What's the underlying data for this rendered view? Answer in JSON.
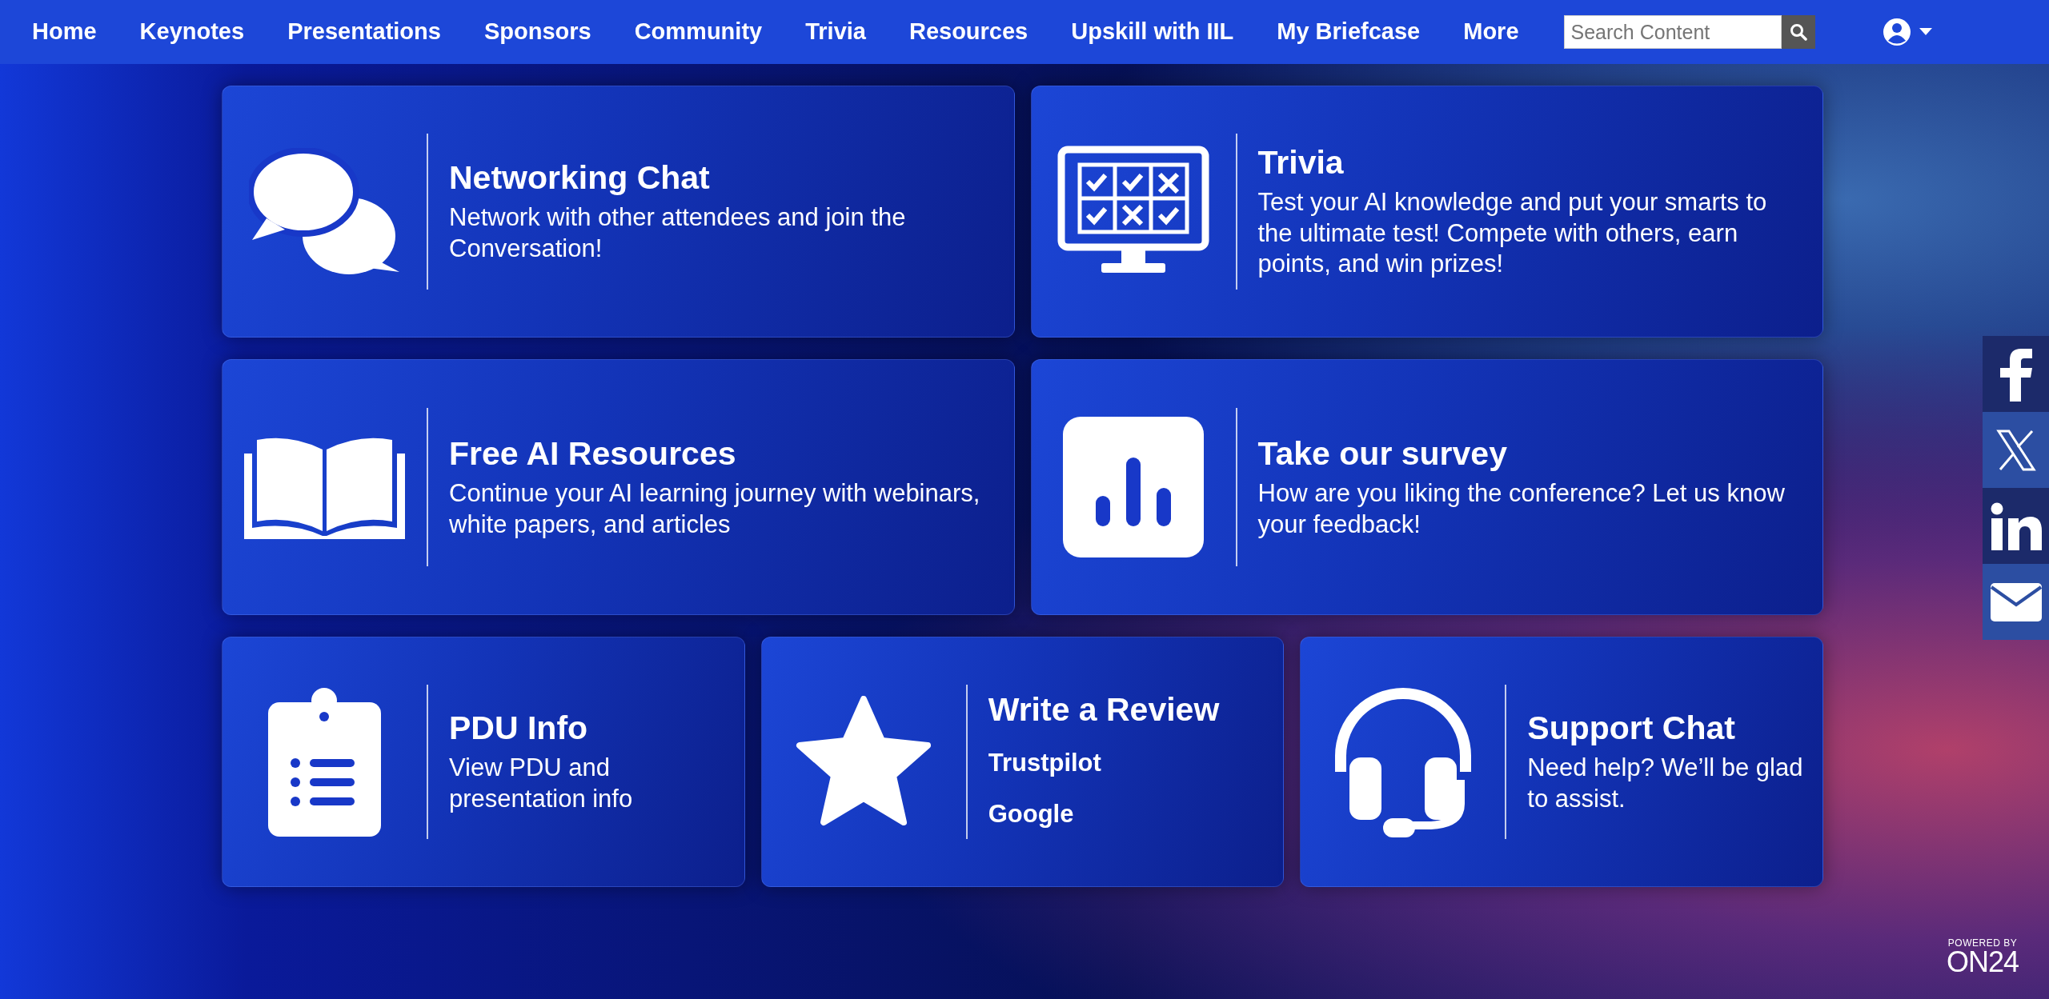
{
  "nav": {
    "items": [
      "Home",
      "Keynotes",
      "Presentations",
      "Sponsors",
      "Community",
      "Trivia",
      "Resources",
      "Upskill with IIL",
      "My Briefcase",
      "More"
    ],
    "search": {
      "placeholder": "Search Content"
    }
  },
  "tile_rows": [
    [
      {
        "kind": "chat",
        "title": "Networking Chat",
        "description": "Network with other attendees and join the Conversation!"
      },
      {
        "kind": "trivia",
        "title": "Trivia",
        "description": "Test your AI knowledge and put your smarts to the ultimate test! Compete with others, earn points, and win prizes!"
      }
    ],
    [
      {
        "kind": "book",
        "title": "Free AI Resources",
        "description": "Continue your AI learning journey with webinars, white papers, and articles"
      },
      {
        "kind": "survey",
        "title": "Take our survey",
        "description": "How are you liking the conference? Let us know your feedback!"
      }
    ],
    [
      {
        "kind": "clipboard",
        "title": "PDU Info",
        "description": "View PDU and presentation info"
      },
      {
        "kind": "star",
        "title": "Write a Review",
        "links": [
          "Trustpilot",
          "Google"
        ]
      },
      {
        "kind": "headset",
        "title": "Support Chat",
        "description": "Need help? We’ll be glad to assist."
      }
    ]
  ],
  "social": [
    {
      "kind": "facebook"
    },
    {
      "kind": "x"
    },
    {
      "kind": "linkedin"
    },
    {
      "kind": "mail"
    }
  ],
  "branding": {
    "caption": "POWERED BY",
    "logo": "ON24"
  }
}
